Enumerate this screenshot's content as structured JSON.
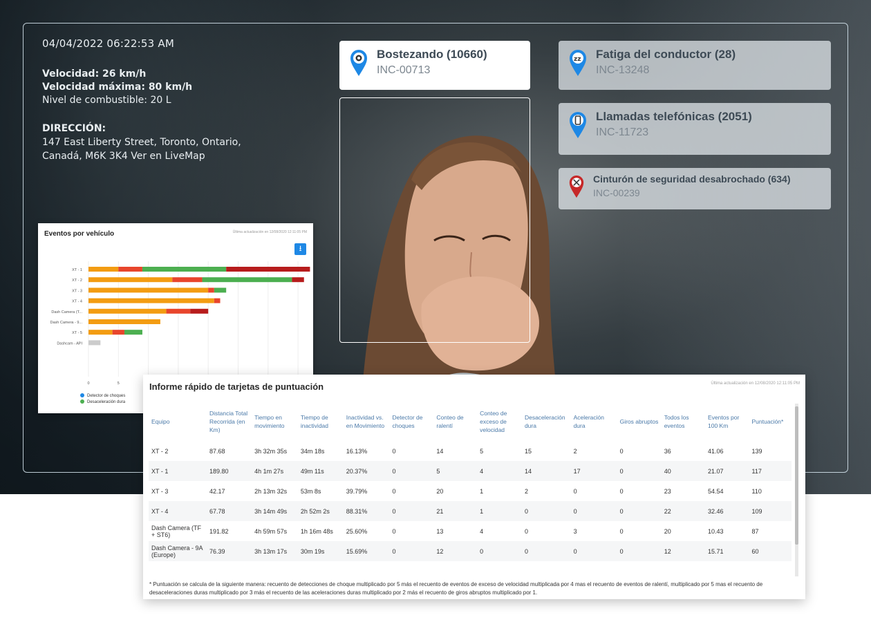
{
  "overlay": {
    "timestamp": "04/04/2022 06:22:53 AM",
    "speed": "Velocidad: 26 km/h",
    "max_speed": "Velocidad máxima: 80 km/h",
    "fuel": "Nivel de combustible: 20 L",
    "direction_label": "DIRECCIÓN:",
    "address": "147 East Liberty Street, Toronto, Ontario, Canadá, M6K 3K4 Ver en LiveMap"
  },
  "events": [
    {
      "title": "Bostezando (10660)",
      "code": "INC-00713",
      "icon": "yawn-camera-icon"
    },
    {
      "title": "Fatiga del conductor (28)",
      "code": "INC-13248",
      "icon": "zz-sleep-icon"
    },
    {
      "title": "Llamadas telefónicas (2051)",
      "code": "INC-11723",
      "icon": "phone-icon"
    },
    {
      "title": "Cinturón de seguridad desabrochado (634)",
      "code": "INC-00239",
      "icon": "seatbelt-icon"
    }
  ],
  "chart_panel": {
    "title": "Eventos por vehículo",
    "updated": "Última actualización en 12/08/2020 12:11:05 PM",
    "download_icon": "download-icon"
  },
  "chart_data": {
    "type": "bar",
    "orientation": "horizontal",
    "stacked": true,
    "categories": [
      "XT - 1",
      "XT - 2",
      "XT - 3",
      "XT - 4",
      "Dash Camera (T...",
      "Dash Camera - 9...",
      "XT - 5",
      "Dashcam - API"
    ],
    "series": [
      {
        "name": "",
        "color": "#f39c12",
        "values": [
          5,
          14,
          20,
          21,
          13,
          12,
          4,
          0
        ]
      },
      {
        "name": "",
        "color": "#e8452c",
        "values": [
          4,
          5,
          1,
          1,
          4,
          0,
          2,
          0
        ]
      },
      {
        "name": "Desaceleración dura",
        "color": "#4caf50",
        "values": [
          14,
          15,
          2,
          0,
          0,
          0,
          3,
          0
        ]
      },
      {
        "name": "",
        "color": "#b71c1c",
        "values": [
          14,
          2,
          0,
          0,
          3,
          0,
          0,
          0
        ]
      },
      {
        "name": "",
        "color": "#cccccc",
        "values": [
          0,
          0,
          0,
          0,
          0,
          0,
          0,
          2
        ]
      }
    ],
    "x_ticks": [
      "0",
      "5"
    ],
    "legend": [
      "Detector de choques",
      "Desaceleración dura"
    ],
    "legend_colors": [
      "#1e88e5",
      "#4caf50"
    ],
    "grid": true
  },
  "scorecard": {
    "title": "Informe rápido de tarjetas de puntuación",
    "updated": "Última actualización en 12/08/2020 12:11:05 PM",
    "columns": [
      "Equipo",
      "Distancia Total Recorrida (en Km)",
      "Tiempo en movimiento",
      "Tiempo de inactividad",
      "Inactividad vs. en Movimiento",
      "Detector de choques",
      "Conteo de ralentí",
      "Conteo de exceso de velocidad",
      "Desaceleración dura",
      "Aceleración dura",
      "Giros abruptos",
      "Todos los eventos",
      "Eventos por 100 Km",
      "Puntuación*"
    ],
    "rows": [
      [
        "XT - 2",
        "87.68",
        "3h 32m 35s",
        "34m 18s",
        "16.13%",
        "0",
        "14",
        "5",
        "15",
        "2",
        "0",
        "36",
        "41.06",
        "139"
      ],
      [
        "XT - 1",
        "189.80",
        "4h 1m 27s",
        "49m 11s",
        "20.37%",
        "0",
        "5",
        "4",
        "14",
        "17",
        "0",
        "40",
        "21.07",
        "117"
      ],
      [
        "XT - 3",
        "42.17",
        "2h 13m 32s",
        "53m 8s",
        "39.79%",
        "0",
        "20",
        "1",
        "2",
        "0",
        "0",
        "23",
        "54.54",
        "110"
      ],
      [
        "XT - 4",
        "67.78",
        "3h 14m 49s",
        "2h 52m 2s",
        "88.31%",
        "0",
        "21",
        "1",
        "0",
        "0",
        "0",
        "22",
        "32.46",
        "109"
      ],
      [
        "Dash Camera (TF + ST6)",
        "191.82",
        "4h 59m 57s",
        "1h 16m 48s",
        "25.60%",
        "0",
        "13",
        "4",
        "0",
        "3",
        "0",
        "20",
        "10.43",
        "87"
      ],
      [
        "Dash Camera - 9A (Europe)",
        "76.39",
        "3h 13m 17s",
        "30m 19s",
        "15.69%",
        "0",
        "12",
        "0",
        "0",
        "0",
        "0",
        "12",
        "15.71",
        "60"
      ]
    ],
    "footnote": "* Puntuación se calcula de la siguiente manera: recuento de detecciones de choque multiplicado por 5 más el recuento de eventos de exceso de velocidad multiplicada por 4 mas el recuento de eventos de ralentí, multiplicado por 5 mas el recuento de desaceleraciones duras multiplicado por 3 más el recuento de las aceleraciones duras multiplicado por 2 más el recuento de giros abruptos multiplicado por 1."
  }
}
